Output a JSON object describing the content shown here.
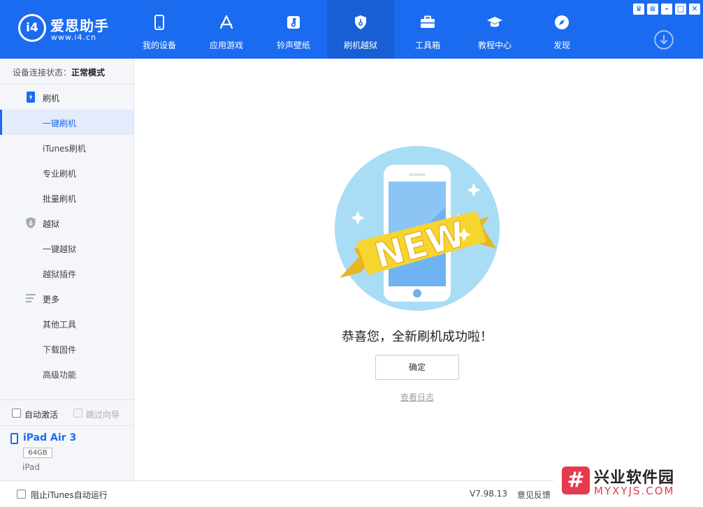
{
  "app": {
    "logo_text": "爱思助手",
    "logo_url": "www.i4.cn",
    "logo_badge": "i4"
  },
  "nav": {
    "items": [
      {
        "label": "我的设备",
        "icon": "phone-icon"
      },
      {
        "label": "应用游戏",
        "icon": "app-store-icon"
      },
      {
        "label": "铃声壁纸",
        "icon": "music-icon"
      },
      {
        "label": "刷机越狱",
        "icon": "shield-icon"
      },
      {
        "label": "工具箱",
        "icon": "toolbox-icon"
      },
      {
        "label": "教程中心",
        "icon": "graduation-cap-icon"
      },
      {
        "label": "发现",
        "icon": "compass-icon"
      }
    ],
    "active_index": 3
  },
  "sidebar": {
    "status_label": "设备连接状态：",
    "status_value": "正常模式",
    "groups": [
      {
        "label": "刷机",
        "items": [
          "一键刷机",
          "iTunes刷机",
          "专业刷机",
          "批量刷机"
        ]
      },
      {
        "label": "越狱",
        "items": [
          "一键越狱",
          "越狱插件"
        ]
      },
      {
        "label": "更多",
        "items": [
          "其他工具",
          "下载固件",
          "高级功能"
        ]
      }
    ],
    "auto_activate_label": "自动激活",
    "skip_guide_label": "跳过向导"
  },
  "device": {
    "name": "iPad Air 3",
    "capacity": "64GB",
    "type": "iPad"
  },
  "main": {
    "badge_text": "NEW",
    "message": "恭喜您，全新刷机成功啦！",
    "ok_label": "确定",
    "log_link": "查看日志"
  },
  "footer": {
    "block_itunes_label": "阻止iTunes自动运行",
    "version": "V7.98.13",
    "feedback": "意见反馈"
  },
  "watermark": {
    "title": "兴业软件园",
    "url": "MYXYJS.COM"
  },
  "colors": {
    "brand": "#1b6bf0",
    "accent_yellow": "#f7d52f"
  }
}
